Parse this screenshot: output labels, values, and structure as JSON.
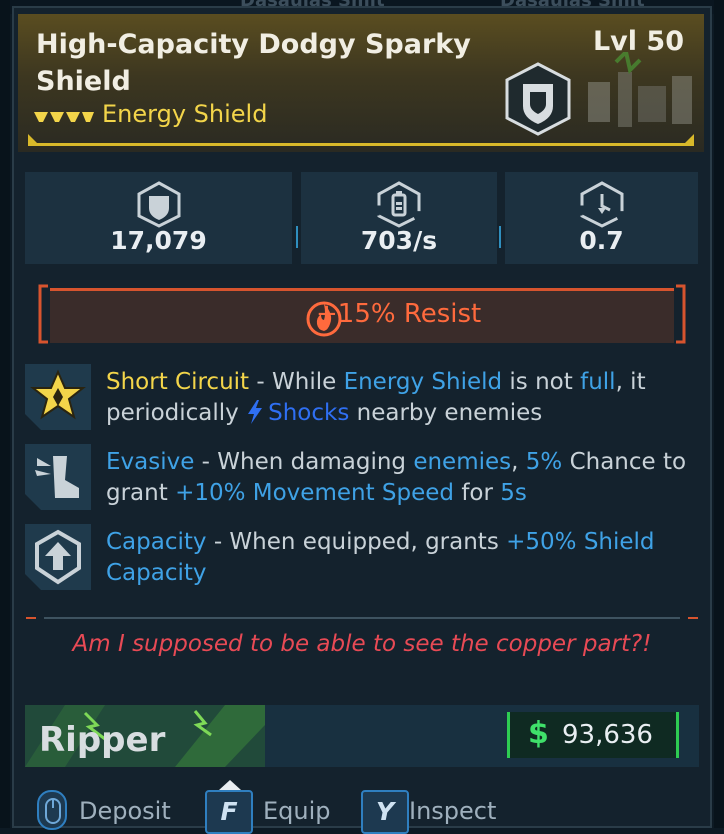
{
  "background_hints": {
    "left_ghost": "Dasaulas Smit",
    "right_ghost": "Dasaulas Smit"
  },
  "item": {
    "name": "High-Capacity Dodgy Sparky Shield",
    "level": "Lvl 50",
    "type": "Energy Shield",
    "rarity_color": "#f3d54a",
    "manufacturer_icon": "shield-badge-icon"
  },
  "stats": [
    {
      "icon": "shield-capacity-icon",
      "value": "17,079"
    },
    {
      "icon": "recharge-rate-icon",
      "value": "703/s"
    },
    {
      "icon": "recharge-delay-icon",
      "value": "0.7"
    }
  ],
  "resist": {
    "icon": "fire-icon",
    "text": "+15% Resist",
    "color": "#ff6a3d"
  },
  "perks": [
    {
      "icon": "star-badge-icon",
      "title": "Short Circuit",
      "t1": " - While ",
      "k1": "Energy Shield",
      "t2": " is not ",
      "k2": "full",
      "t3": ", it periodically ",
      "k3_icon": "lightning-icon",
      "k3": "Shocks",
      "t4": " nearby enemies"
    },
    {
      "icon": "winged-boot-icon",
      "title": "Evasive",
      "t1": " - When damaging ",
      "k1": "enemies",
      "t2": ", ",
      "k2": "5%",
      "t3": " Chance to grant ",
      "k3": "+10% Movement Speed",
      "t4": " for ",
      "k4": "5s"
    },
    {
      "icon": "shield-arrow-up-icon",
      "title": "Capacity",
      "t1": " - When equipped, grants ",
      "k1": "+50% Shield Capacity"
    }
  ],
  "flavor_text": "Am I supposed to be able to see the copper part?!",
  "manufacturer_logo": "Ripper",
  "price": {
    "symbol": "$",
    "amount": "93,636"
  },
  "actions": [
    {
      "key": "",
      "key_icon": "mouse-icon",
      "label": "Deposit"
    },
    {
      "key": "F",
      "label": "Equip"
    },
    {
      "key": "Y",
      "label": "Inspect"
    }
  ]
}
